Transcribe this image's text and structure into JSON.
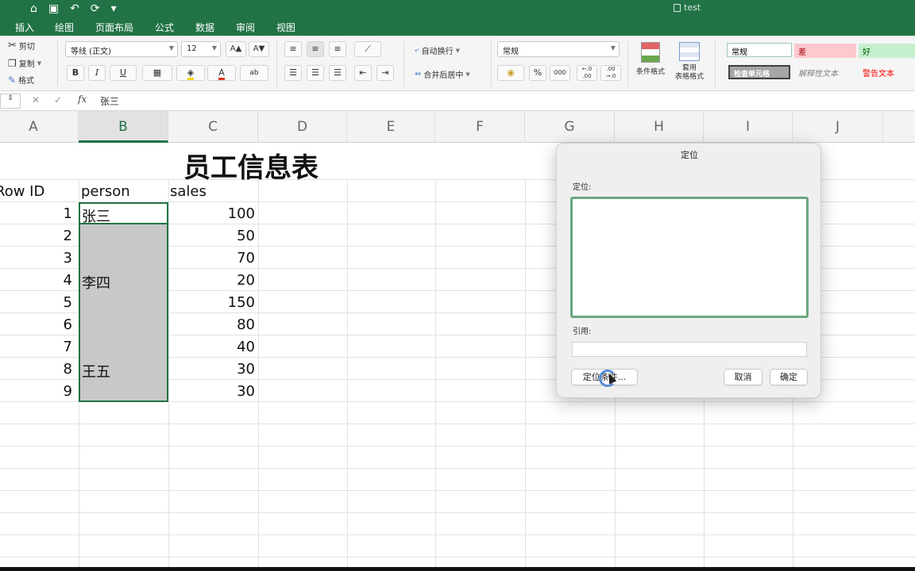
{
  "titlebar": {
    "qat_icons": [
      "home-icon",
      "save-icon",
      "undo-icon",
      "redo-icon",
      "customize-icon"
    ],
    "qat_glyphs": [
      "⌂",
      "▣",
      "↶",
      "⟳",
      "▾"
    ],
    "doc_name": "test"
  },
  "tabs": [
    "插入",
    "绘图",
    "页面布局",
    "公式",
    "数据",
    "审阅",
    "视图"
  ],
  "ribbon": {
    "clipboard": {
      "cut": "剪切",
      "copy": "复制",
      "format_painter": "格式"
    },
    "font": {
      "name": "等线 (正文)",
      "size": "12",
      "grow": "A▲",
      "shrink": "A▼",
      "bold": "B",
      "italic": "I",
      "underline": "U",
      "font_color_glyph": "A",
      "phonetic_glyph": "ab"
    },
    "alignment": {
      "wrap_text": "自动换行",
      "merge_center": "合并后居中"
    },
    "number": {
      "format": "常规",
      "percent": "%",
      "comma": "000",
      "inc_decimal": "←.0 .00",
      "dec_decimal": ".00 →.0"
    },
    "styles": {
      "conditional": "条件格式",
      "table_format_line1": "套用",
      "table_format_line2": "表格格式"
    },
    "cell_styles": {
      "normal": "常规",
      "bad": "差",
      "good": "好",
      "check_cell": "检查单元格",
      "explanatory": "解释性文本",
      "warning": "警告文本"
    }
  },
  "formula_bar": {
    "name_box": "",
    "fx": "fx",
    "value": "张三"
  },
  "columns": [
    "A",
    "B",
    "C",
    "D",
    "E",
    "F",
    "G",
    "H",
    "I",
    "J"
  ],
  "sheet": {
    "title": "员工信息表",
    "headers": {
      "row_id": "Row ID",
      "person": "person",
      "sales": "sales"
    },
    "rows": [
      {
        "id": "1",
        "person": "张三",
        "sales": "100"
      },
      {
        "id": "2",
        "person": "",
        "sales": "50"
      },
      {
        "id": "3",
        "person": "",
        "sales": "70"
      },
      {
        "id": "4",
        "person": "李四",
        "sales": "20"
      },
      {
        "id": "5",
        "person": "",
        "sales": "150"
      },
      {
        "id": "6",
        "person": "",
        "sales": "80"
      },
      {
        "id": "7",
        "person": "",
        "sales": "40"
      },
      {
        "id": "8",
        "person": "王五",
        "sales": "30"
      },
      {
        "id": "9",
        "person": "",
        "sales": "30"
      }
    ]
  },
  "dialog": {
    "title": "定位",
    "goto_label": "定位:",
    "reference_label": "引用:",
    "reference_value": "",
    "special_button": "定位条件...",
    "cancel_button": "取消",
    "ok_button": "确定"
  },
  "colors": {
    "accent": "#217346",
    "selection_fill": "#c8c8c8",
    "bad_fill": "#ffc7ce",
    "good_fill": "#c6efce",
    "check_fill": "#a5a5a5"
  }
}
